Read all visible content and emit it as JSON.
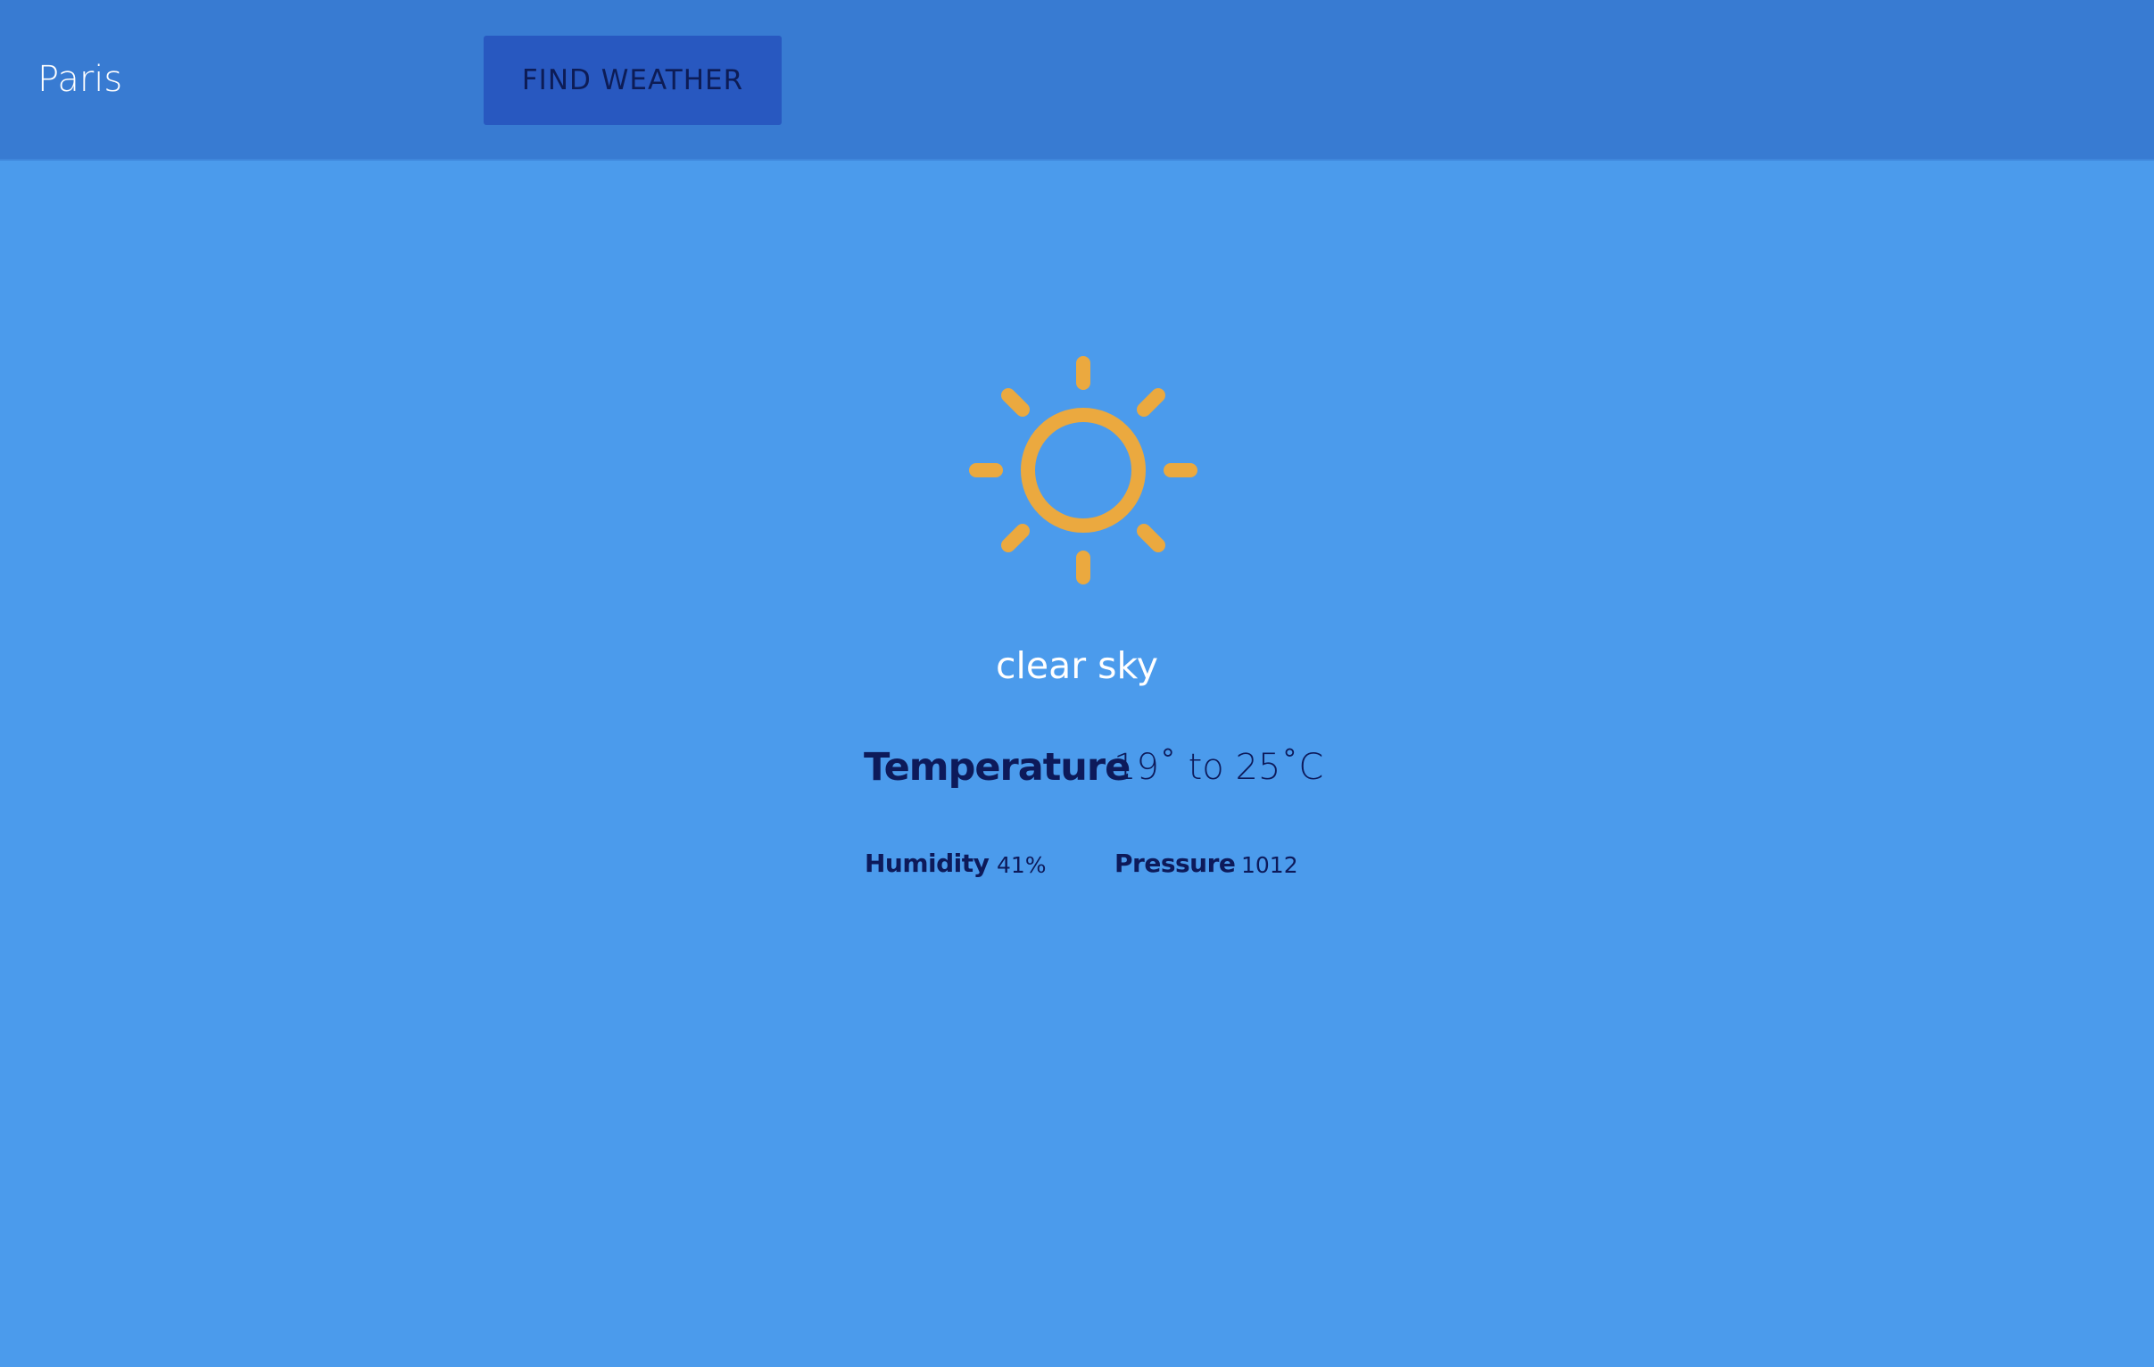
{
  "search": {
    "city_value": "Paris",
    "button_label": "FIND WEATHER"
  },
  "weather": {
    "icon": "sun-icon",
    "description": "clear sky",
    "temperature_label": "Temperature",
    "temperature_value": "19˚ to 25˚C",
    "humidity_label": "Humidity",
    "humidity_value": "41%",
    "pressure_label": "Pressure",
    "pressure_value": "1012"
  },
  "colors": {
    "background": "#4b9bec",
    "topbar": "#387bd2",
    "button": "#2858c0",
    "sun": "#eba93f",
    "dark_text": "#0d1a5a"
  }
}
